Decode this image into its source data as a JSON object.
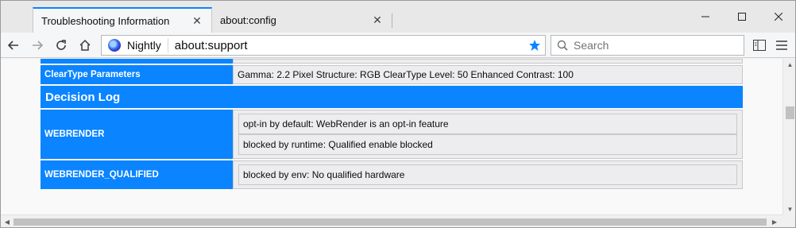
{
  "tabs": [
    {
      "title": "Troubleshooting Information",
      "active": true
    },
    {
      "title": "about:config",
      "active": false
    }
  ],
  "urlbar": {
    "brand": "Nightly",
    "url": "about:support"
  },
  "search": {
    "placeholder": "Search"
  },
  "rows": {
    "cleartype": {
      "key": "ClearType Parameters",
      "value": "Gamma: 2.2 Pixel Structure: RGB ClearType Level: 50 Enhanced Contrast: 100"
    }
  },
  "section": {
    "title": "Decision Log"
  },
  "decision_log": [
    {
      "key": "WEBRENDER",
      "values": [
        "opt-in by default: WebRender is an opt-in feature",
        "blocked by runtime: Qualified enable blocked"
      ]
    },
    {
      "key": "WEBRENDER_QUALIFIED",
      "values": [
        "blocked by env: No qualified hardware"
      ]
    }
  ],
  "colors": {
    "accent": "#0a84ff"
  }
}
